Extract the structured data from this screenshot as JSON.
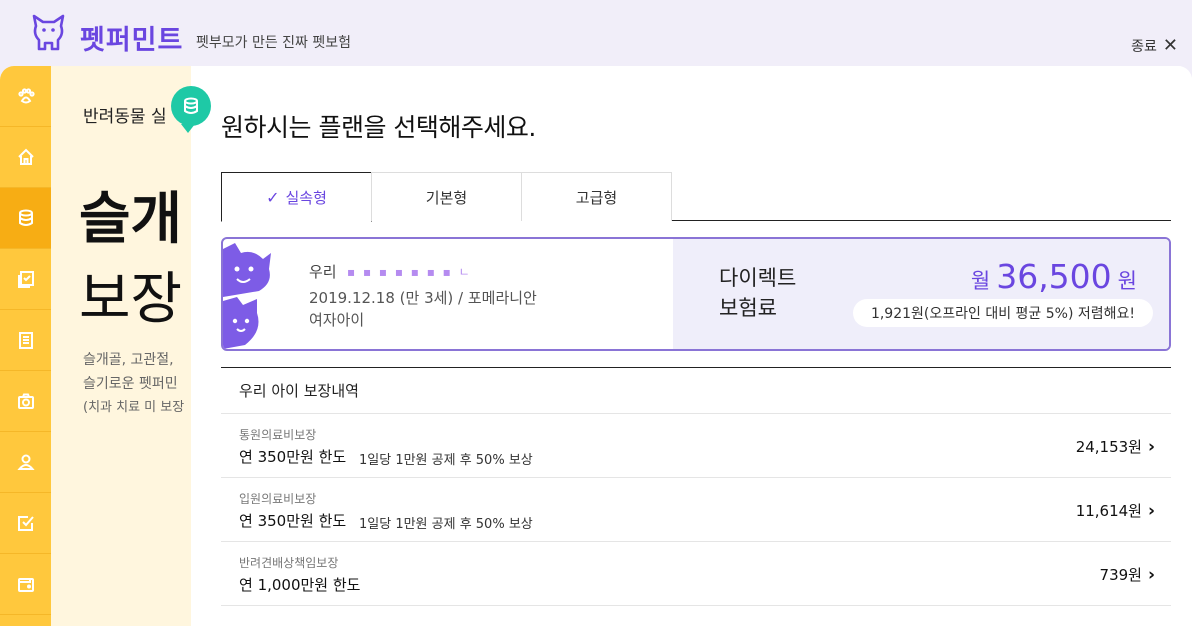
{
  "header": {
    "brand": "펫퍼민트",
    "tagline": "펫부모가 만든 진짜 펫보험",
    "close_label": "종료",
    "logo_icon": "dog-logo-icon",
    "close_icon": "close-icon"
  },
  "sidebar": {
    "items": [
      {
        "icon": "paw-icon"
      },
      {
        "icon": "home-icon"
      },
      {
        "icon": "database-icon",
        "active": true
      },
      {
        "icon": "checklist-icon"
      },
      {
        "icon": "document-icon"
      },
      {
        "icon": "camera-icon"
      },
      {
        "icon": "person-icon"
      },
      {
        "icon": "checkbox-icon"
      },
      {
        "icon": "wallet-icon"
      }
    ]
  },
  "background": {
    "sub": "반려동물 실",
    "heading1": "슬개",
    "heading2": "보장",
    "desc": [
      "슬개골, 고관절,",
      "슬기로운 펫퍼민",
      "(치과 치료 미 보장"
    ]
  },
  "modal": {
    "title": "원하시는 플랜을 선택해주세요.",
    "tabs": [
      {
        "label": "실속형",
        "active": true
      },
      {
        "label": "기본형",
        "active": false
      },
      {
        "label": "고급형",
        "active": false
      }
    ],
    "plan": {
      "pet_name_label": "우리",
      "pet_name_masked": "▪ ▪ ▪ ▪ ▪ ▪ ▪ ㄴ",
      "pet_info": "2019.12.18 (만 3세) / 포메라니안",
      "pet_gender": "여자아이",
      "premium_label_1": "다이렉트",
      "premium_label_2": "보험료",
      "price_prefix": "월",
      "price_value": "36,500",
      "price_suffix": "원",
      "discount_text": "1,921원(오프라인 대비 평균 5%) 저렴해요!"
    },
    "coverage": {
      "heading": "우리 아이 보장내역",
      "rows": [
        {
          "category": "통원의료비보장",
          "limit": "연 350만원 한도",
          "detail": "1일당 1만원 공제 후 50% 보상",
          "amount": "24,153원"
        },
        {
          "category": "입원의료비보장",
          "limit": "연 350만원 한도",
          "detail": "1일당 1만원 공제 후 50% 보상",
          "amount": "11,614원"
        },
        {
          "category": "반려견배상책임보장",
          "limit": "연 1,000만원 한도",
          "detail": "",
          "amount": "739원"
        }
      ]
    }
  },
  "colors": {
    "brand": "#6a46e0",
    "sidebar": "#ffc83d",
    "sidebar_active": "#f7ad14",
    "badge": "#1ec9a6",
    "card_border": "#8a74d6"
  }
}
